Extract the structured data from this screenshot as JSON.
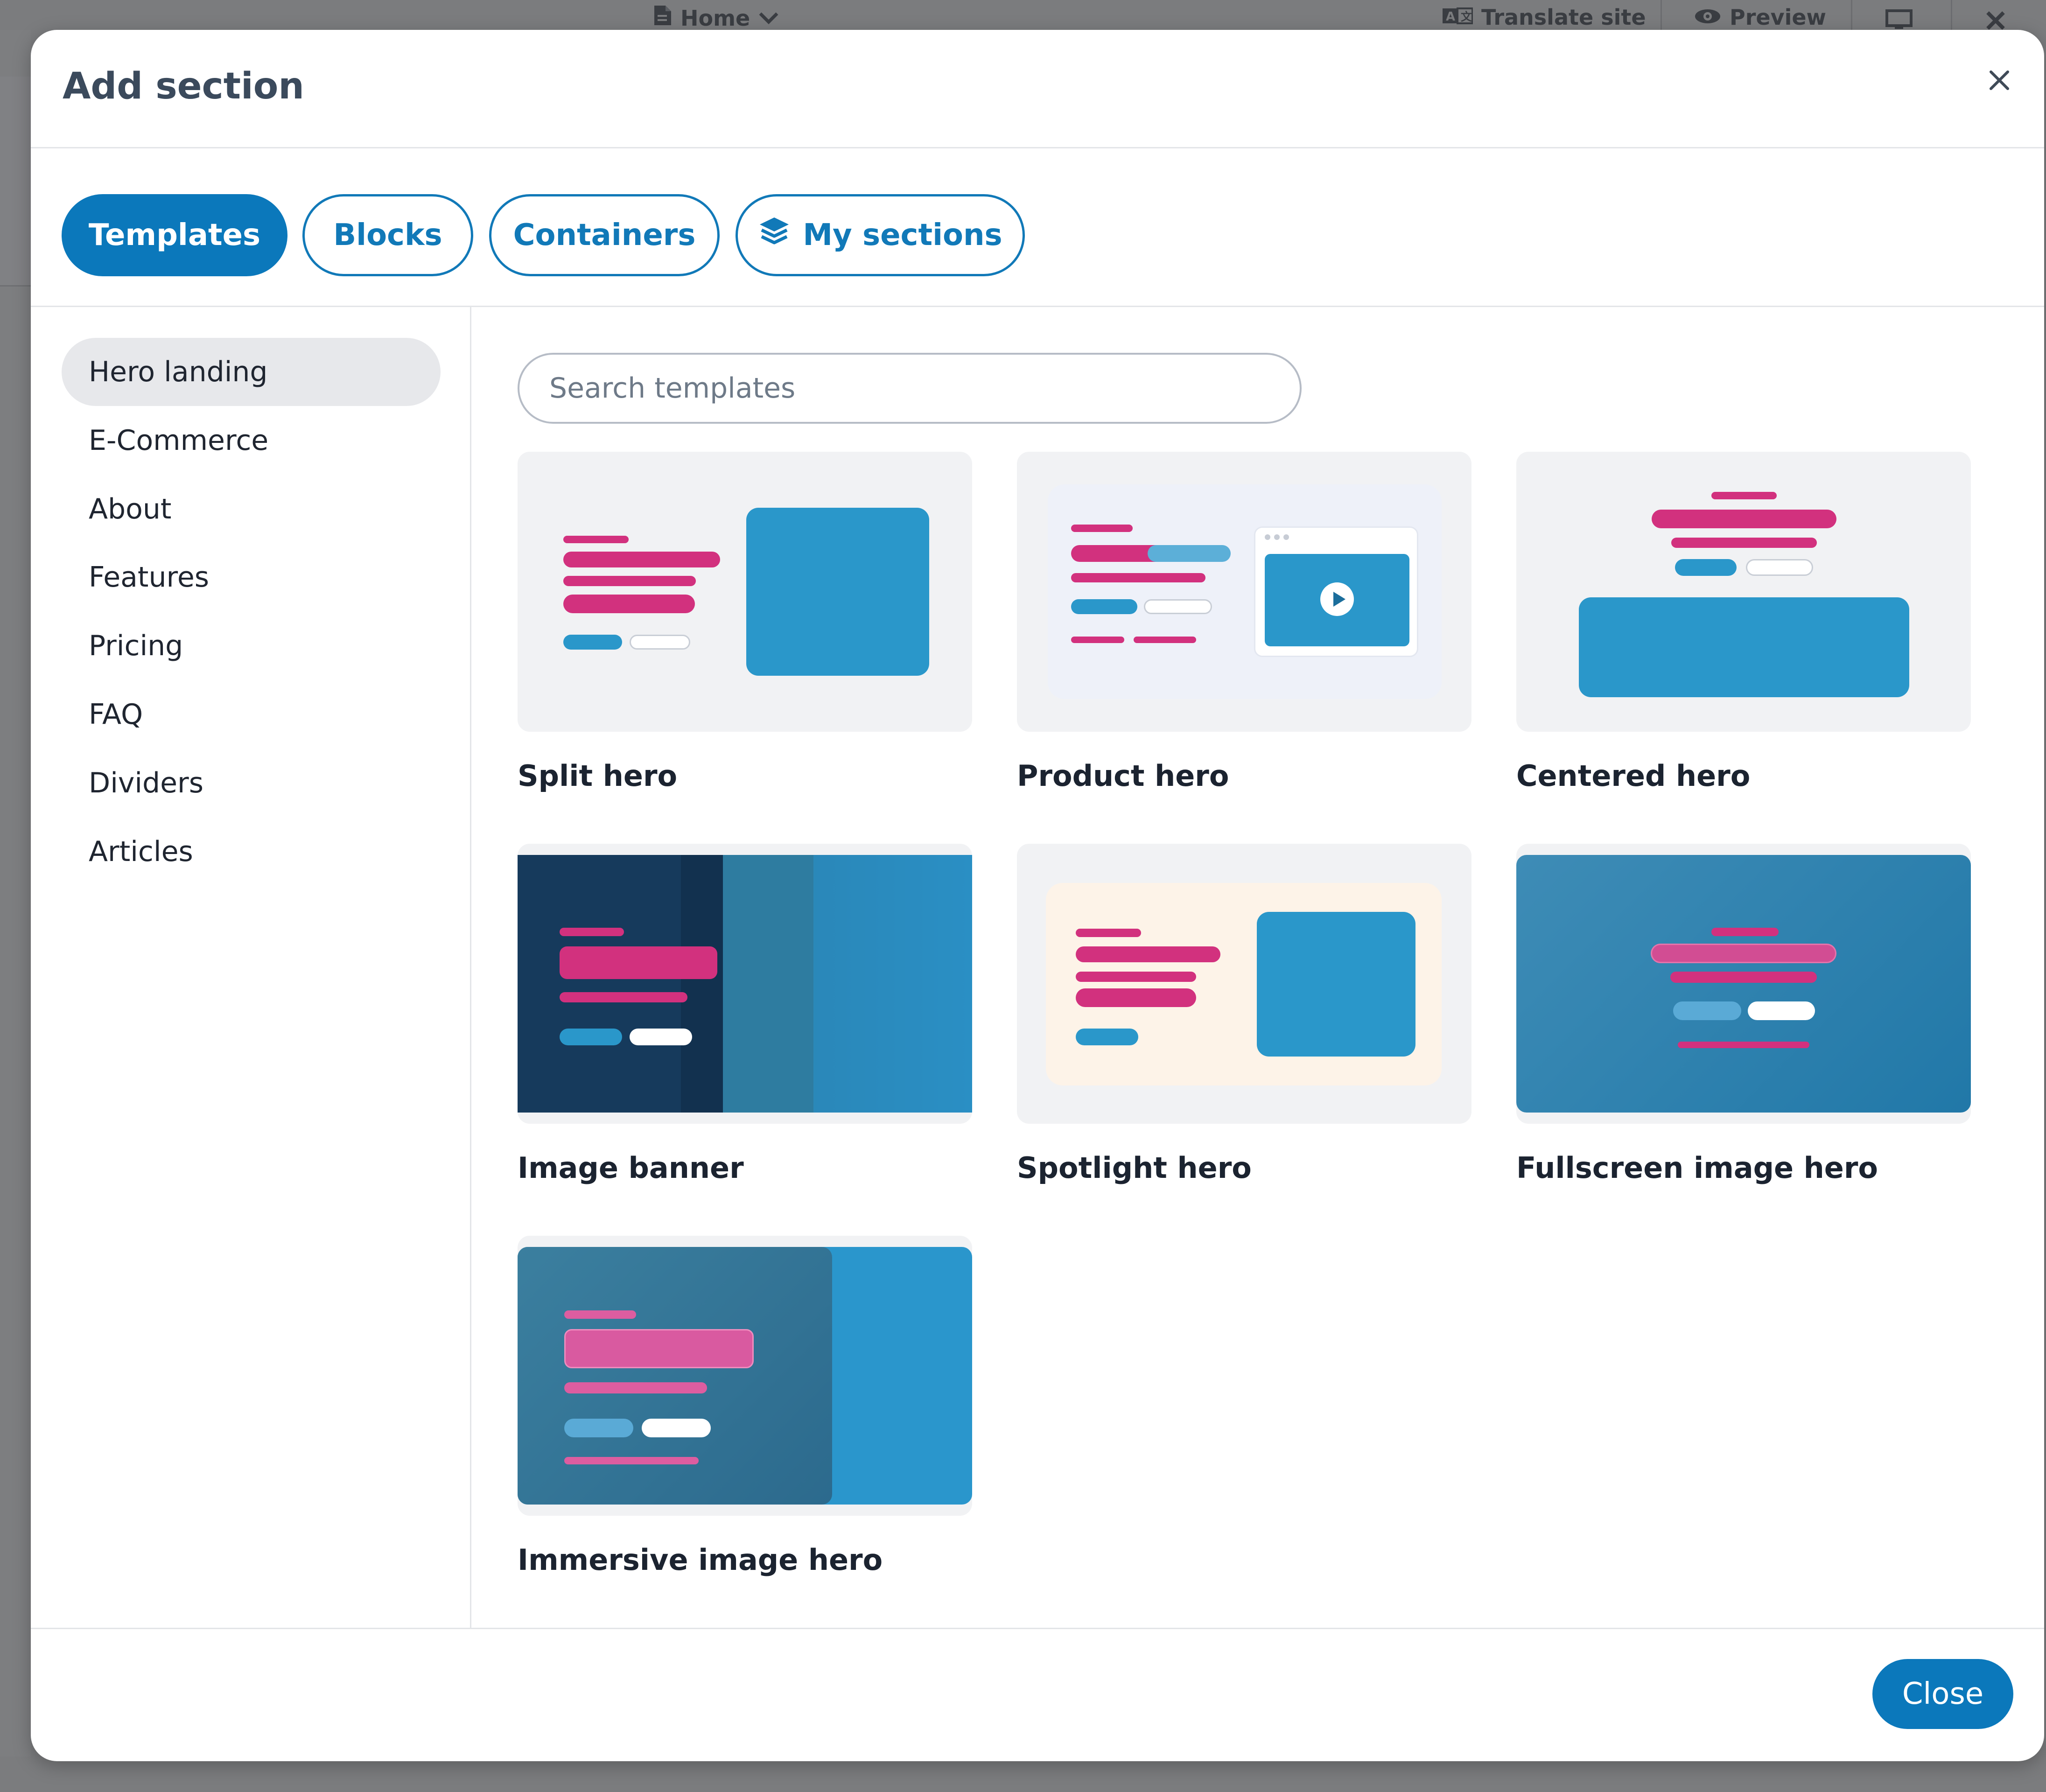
{
  "app_topbar": {
    "page_label": "Home",
    "translate_label": "Translate site",
    "preview_label": "Preview"
  },
  "modal": {
    "title": "Add section",
    "tabs": [
      {
        "label": "Templates",
        "active": true
      },
      {
        "label": "Blocks",
        "active": false
      },
      {
        "label": "Containers",
        "active": false
      },
      {
        "label": "My sections",
        "active": false,
        "icon": "layers-icon"
      }
    ],
    "categories": [
      {
        "label": "Hero landing",
        "active": true
      },
      {
        "label": "E-Commerce",
        "active": false
      },
      {
        "label": "About",
        "active": false
      },
      {
        "label": "Features",
        "active": false
      },
      {
        "label": "Pricing",
        "active": false
      },
      {
        "label": "FAQ",
        "active": false
      },
      {
        "label": "Dividers",
        "active": false
      },
      {
        "label": "Articles",
        "active": false
      }
    ],
    "search": {
      "placeholder": "Search templates",
      "value": ""
    },
    "templates": [
      {
        "label": "Split hero"
      },
      {
        "label": "Product hero"
      },
      {
        "label": "Centered hero"
      },
      {
        "label": "Image banner"
      },
      {
        "label": "Spotlight hero"
      },
      {
        "label": "Fullscreen image hero"
      },
      {
        "label": "Immersive image hero"
      }
    ],
    "footer": {
      "close_label": "Close"
    }
  },
  "colors": {
    "accent": "#0b78bb",
    "preview_magenta": "#d2317e",
    "preview_blue": "#2a97ca",
    "preview_navy": "#15375a",
    "overlay": "#7b7c7e"
  }
}
